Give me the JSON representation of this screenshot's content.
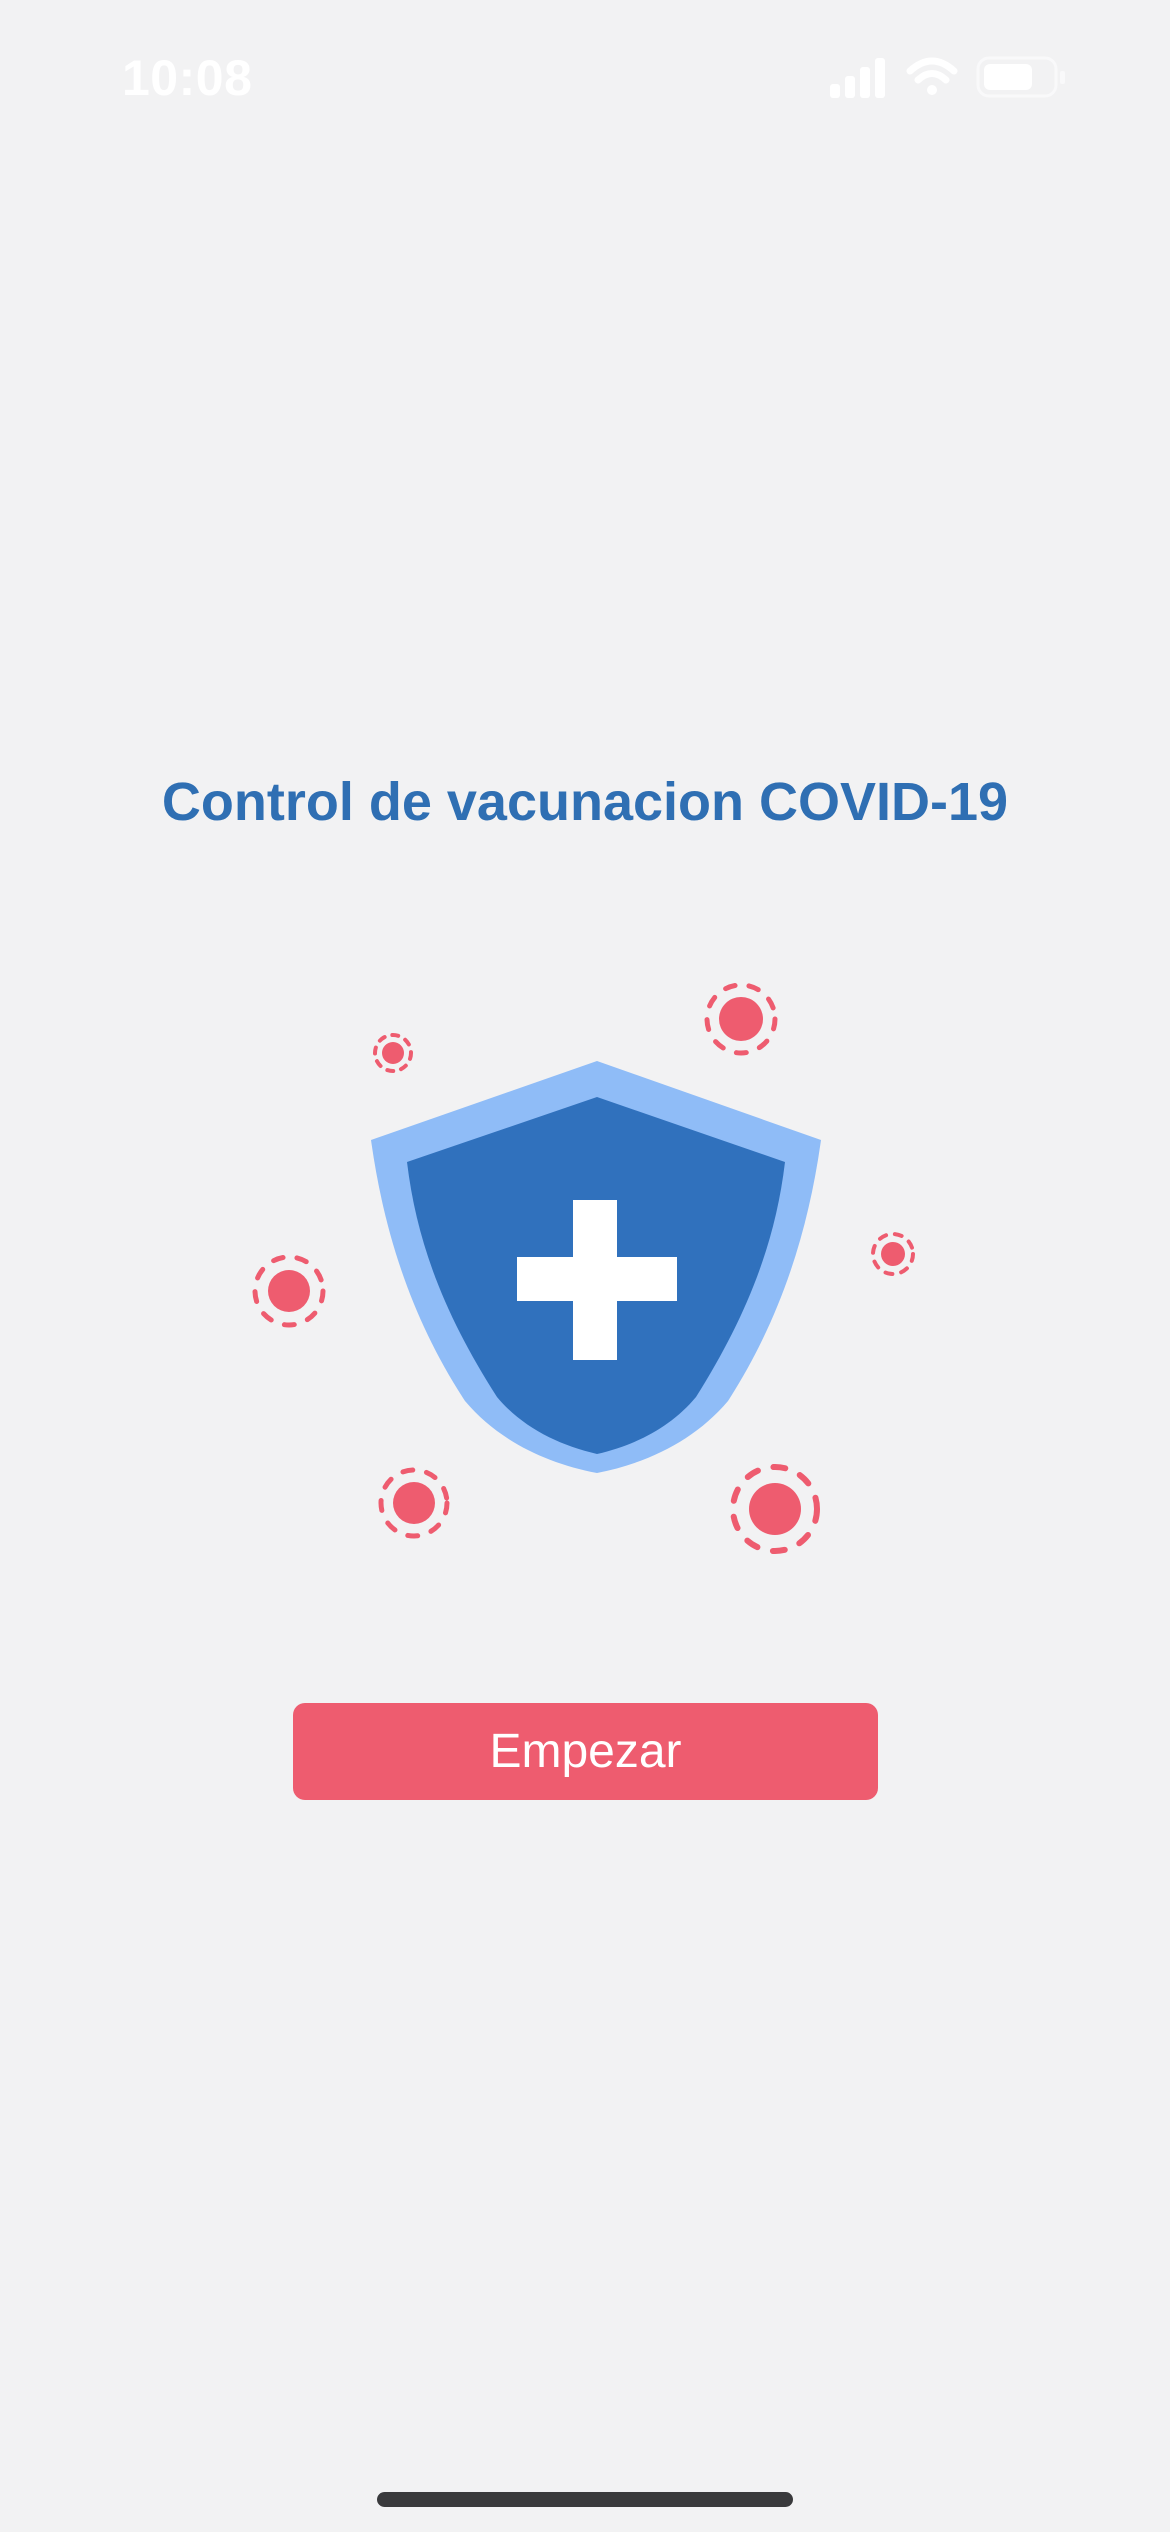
{
  "status_bar": {
    "time": "10:08",
    "icons": [
      "signal-icon",
      "wifi-icon",
      "battery-icon"
    ]
  },
  "screen": {
    "title": "Control de vacunacion COVID-19",
    "illustration": {
      "icon": "shield-plus-icon",
      "decorations": "virus-icon"
    },
    "start_button_label": "Empezar"
  },
  "colors": {
    "background": "#f2f2f3",
    "title": "#2f6fb3",
    "shield_outer": "#8fbcf7",
    "shield_inner": "#3071bd",
    "accent": "#ee5c6f"
  }
}
